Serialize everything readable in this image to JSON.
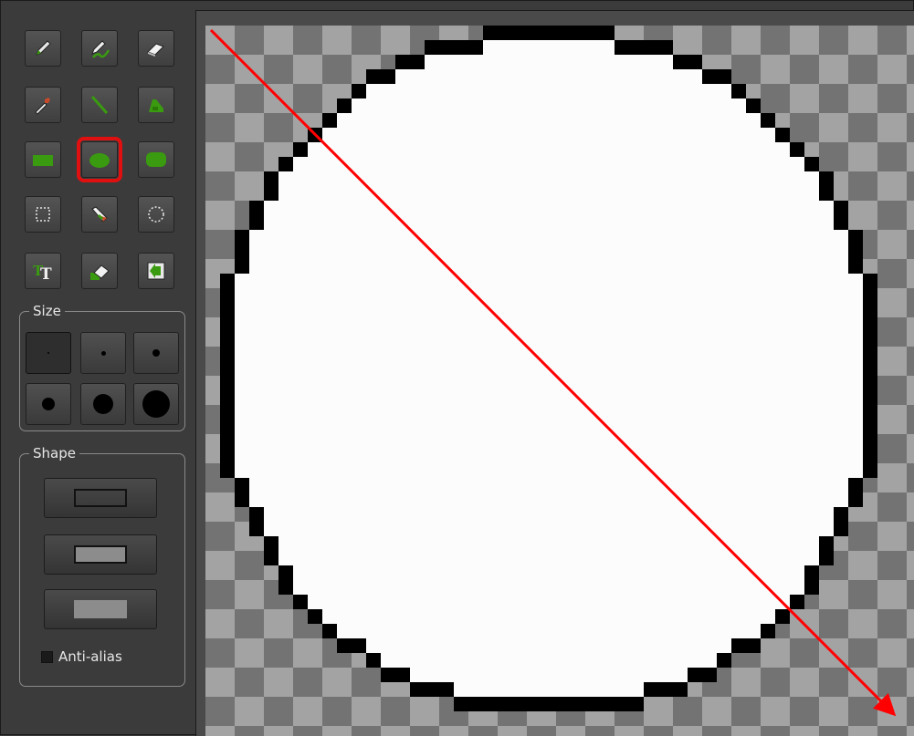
{
  "toolbox": {
    "tools": [
      {
        "icon": "pencil-icon",
        "selected": false
      },
      {
        "icon": "color-replace-pencil-icon",
        "selected": false
      },
      {
        "icon": "eraser-icon",
        "selected": false
      },
      {
        "icon": "color-picker-icon",
        "selected": false
      },
      {
        "icon": "line-icon",
        "selected": false
      },
      {
        "icon": "fill-bucket-icon",
        "selected": false
      },
      {
        "icon": "rectangle-icon",
        "selected": false
      },
      {
        "icon": "ellipse-icon",
        "selected": true
      },
      {
        "icon": "rounded-rectangle-icon",
        "selected": false
      },
      {
        "icon": "rectangle-select-icon",
        "selected": false
      },
      {
        "icon": "magic-wand-icon",
        "selected": false
      },
      {
        "icon": "ellipse-select-icon",
        "selected": false
      },
      {
        "icon": "text-icon",
        "selected": false
      },
      {
        "icon": "eraser-brush-icon",
        "selected": false
      },
      {
        "icon": "import-icon",
        "selected": false
      }
    ],
    "size": {
      "legend": "Size",
      "options": [
        1,
        2,
        3,
        4,
        5,
        6
      ],
      "selected": 1
    },
    "shape": {
      "legend": "Shape",
      "options": [
        "outline",
        "outline-fill",
        "fill"
      ],
      "selected": null
    },
    "anti_alias": {
      "label": "Anti-alias",
      "checked": false
    }
  },
  "canvas": {
    "shape": "ellipse",
    "fill_color": "#fcfcfc",
    "outline_color": "#000000",
    "transparency_light": "#a3a3a3",
    "transparency_dark": "#737373"
  },
  "annotation": {
    "type": "arrow",
    "color": "#ff0000",
    "direction": "top-left to bottom-right"
  },
  "colors": {
    "selection_highlight": "#e01010",
    "accent_green": "#3a9a10"
  }
}
